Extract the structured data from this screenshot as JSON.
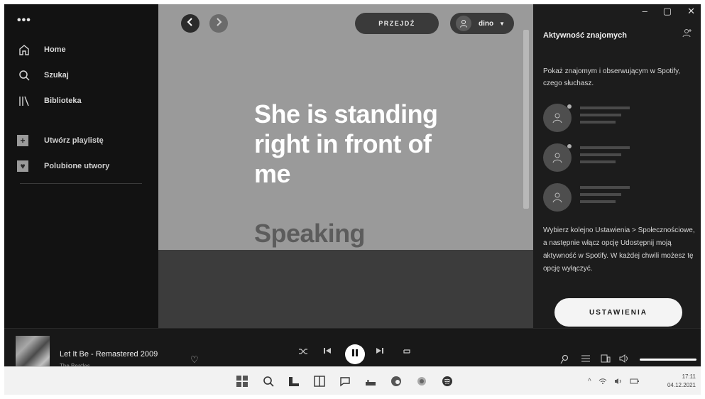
{
  "sidebar": {
    "menu_label": "•••",
    "nav": [
      {
        "label": "Home",
        "icon": "home-icon"
      },
      {
        "label": "Szukaj",
        "icon": "search-icon"
      },
      {
        "label": "Biblioteka",
        "icon": "library-icon"
      }
    ],
    "playlists": [
      {
        "label": "Utwórz playlistę",
        "icon": "plus-icon"
      },
      {
        "label": "Polubione utwory",
        "icon": "heart-icon"
      }
    ]
  },
  "header": {
    "przejdz_label": "PRZEJDŹ",
    "user_name": "dino"
  },
  "lyrics": {
    "current": "She is standing right in front of me",
    "next": "Speaking"
  },
  "friends": {
    "title": "Aktywność znajomych",
    "intro": "Pokaż znajomym i obserwującym w Spotify, czego słuchasz.",
    "help": "Wybierz kolejno Ustawienia > Społecznościowe, a następnie włącz opcję Udostępnij moją aktywność w Spotify. W każdej chwili możesz tę opcję wyłączyć.",
    "settings_button": "USTAWIENIA"
  },
  "window_controls": {
    "minimize": "–",
    "maximize": "▢",
    "close": "✕"
  },
  "player": {
    "track_title": "Let It Be - Remastered 2009",
    "track_artist": "The Beatles",
    "volume": 1.0
  },
  "taskbar": {
    "time": "17:11",
    "date": "04.12.2021"
  },
  "colors": {
    "background": "#121212",
    "lyrics_bg": "#9a9a9a",
    "panel": "#1c1c1c",
    "accent": "#ffffff"
  }
}
